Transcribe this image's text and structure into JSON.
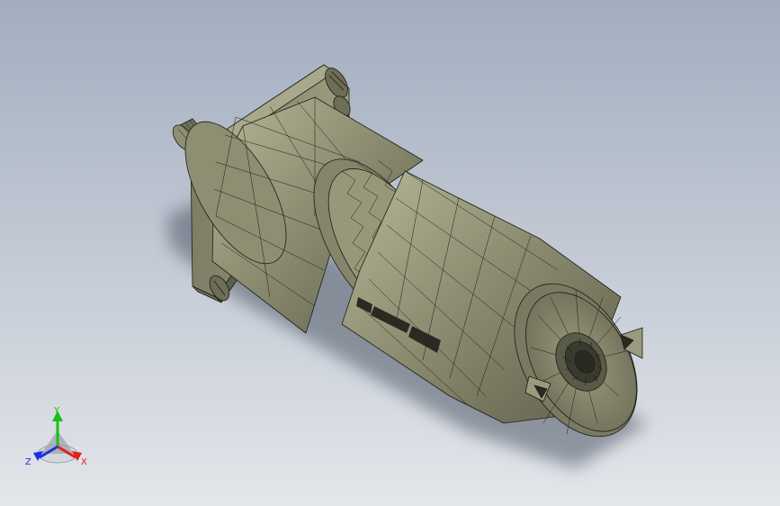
{
  "viewport": {
    "background_top": "#a2adbf",
    "background_bottom": "#e3e6ea"
  },
  "model": {
    "body_color": "#8e8e73",
    "body_shadow": "#5f5f4c",
    "body_highlight": "#b6b697",
    "edge_color": "#1d1d16",
    "cast_shadow": "#505866"
  },
  "triad": {
    "x_label": "X",
    "y_label": "Y",
    "z_label": "Z",
    "x_color": "#e02020",
    "y_color": "#18c018",
    "z_color": "#2030e0"
  }
}
